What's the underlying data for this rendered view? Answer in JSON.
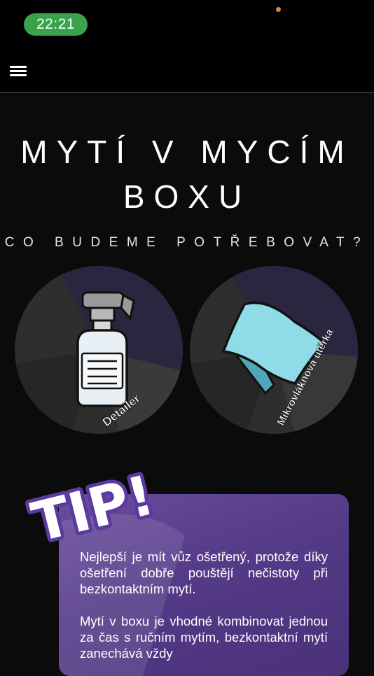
{
  "status_bar": {
    "time": "22:21",
    "time_pill_color": "#3aa24a"
  },
  "app_bar": {
    "menu_icon": "hamburger-menu-icon"
  },
  "page": {
    "title_line1": "MYTÍ V MYCÍM",
    "title_line2": "BOXU",
    "subtitle": "CO BUDEME POTŘEBOVAT?"
  },
  "items": [
    {
      "label": "Detailer",
      "icon": "spray-bottle-icon"
    },
    {
      "label": "Mikrovláknová utěrka",
      "icon": "microfiber-cloth-icon"
    }
  ],
  "tip": {
    "badge": "TIP!",
    "paragraph1": "Nejlepší je mít vůz ošetřený, protože díky ošetření dobře pouštějí nečistoty při bezkontaktním mytí.",
    "paragraph2": "Mytí v boxu je vhodné kombinovat jednou za čas s ručním mytím, bezkontaktní mytí zanechává vždy",
    "card_color": "#553a88"
  }
}
